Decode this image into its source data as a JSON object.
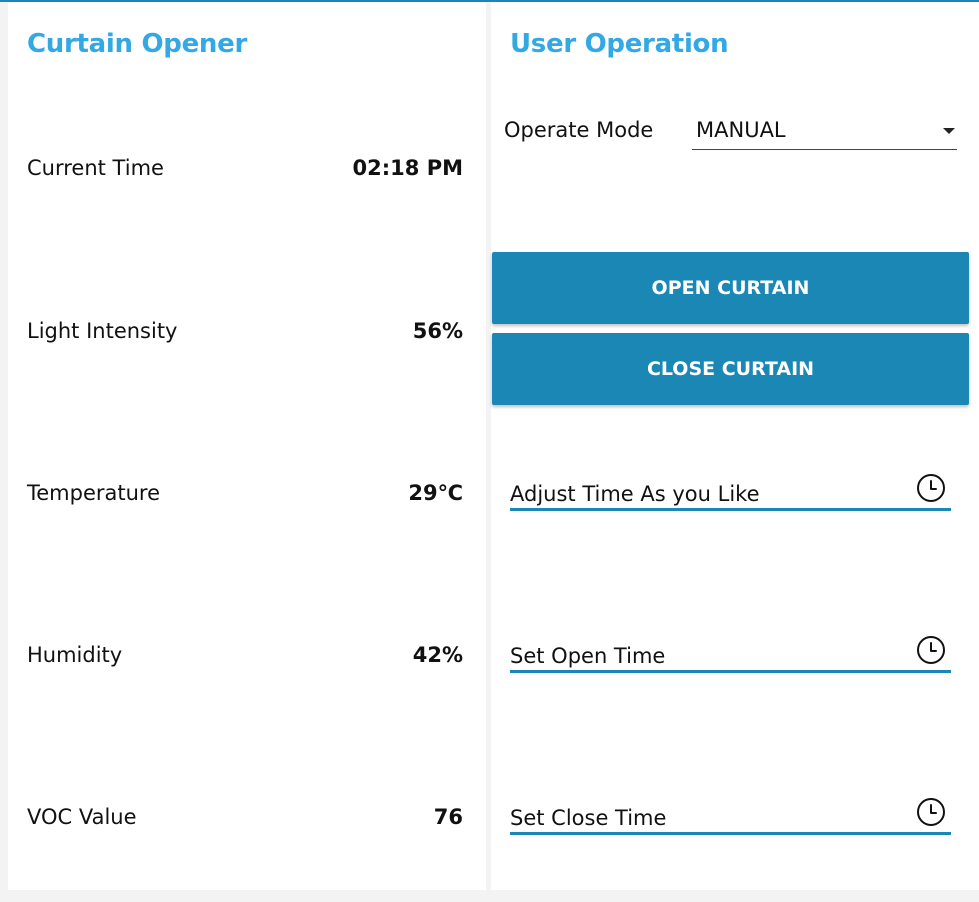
{
  "left_panel": {
    "title": "Curtain Opener",
    "stats": [
      {
        "label": "Current Time",
        "value": "02:18 PM"
      },
      {
        "label": "Light Intensity",
        "value": "56%"
      },
      {
        "label": "Temperature",
        "value": "29℃"
      },
      {
        "label": "Humidity",
        "value": "42%"
      },
      {
        "label": "VOC Value",
        "value": "76"
      }
    ]
  },
  "right_panel": {
    "title": "User Operation",
    "mode": {
      "label": "Operate Mode",
      "selected": "MANUAL"
    },
    "buttons": {
      "open": "OPEN CURTAIN",
      "close": "CLOSE CURTAIN"
    },
    "time_fields": [
      {
        "text": "Adjust Time As you Like",
        "icon": "clock-icon"
      },
      {
        "text": "Set Open Time",
        "icon": "clock-icon"
      },
      {
        "text": "Set Close Time",
        "icon": "clock-icon"
      }
    ]
  },
  "colors": {
    "accent": "#32a9e4",
    "button": "#1b87b5",
    "background": "#f3f3f3",
    "panel": "#ffffff"
  }
}
